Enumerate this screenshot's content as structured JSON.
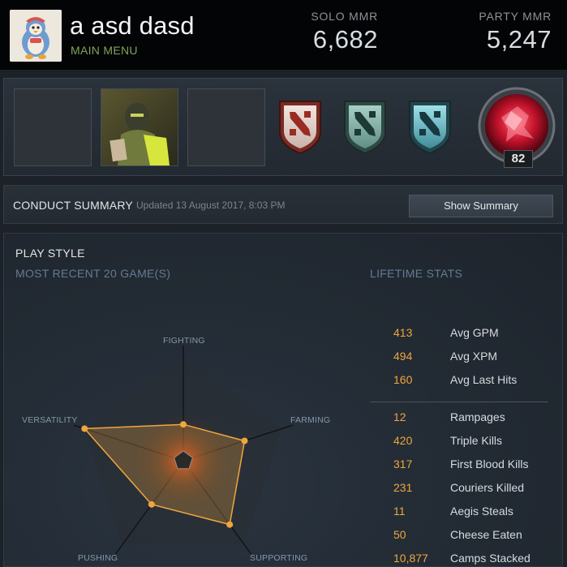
{
  "profile": {
    "player_name": "a asd dasd",
    "main_menu_label": "MAIN MENU",
    "avatar_icon": "penguin-avatar",
    "solo_mmr_label": "SOLO MMR",
    "solo_mmr_value": "6,682",
    "party_mmr_label": "PARTY MMR",
    "party_mmr_value": "5,247"
  },
  "showcase": {
    "hero_slots": [
      "empty-slot",
      "hero-portrait",
      "empty-slot"
    ],
    "badges": [
      "dota-badge-red",
      "dota-badge-teal",
      "dota-badge-cyan"
    ],
    "level_medal_icon": "level-medal",
    "level": "82"
  },
  "conduct": {
    "title": "CONDUCT SUMMARY",
    "updated": "Updated 13 August 2017, 8:03 PM",
    "button_label": "Show Summary"
  },
  "play_style": {
    "title": "PLAY STYLE",
    "recent_label": "MOST RECENT 20 GAME(S)",
    "lifetime_label": "LIFETIME STATS",
    "axes": [
      "FIGHTING",
      "FARMING",
      "SUPPORTING",
      "PUSHING",
      "VERSATILITY"
    ],
    "scores": {
      "FIGHTING": 0.35,
      "FARMING": 0.62,
      "SUPPORTING": 0.76,
      "PUSHING": 0.52,
      "VERSATILITY": 1.0
    }
  },
  "lifetime_stats": {
    "group1": [
      {
        "value": "413",
        "label": "Avg GPM"
      },
      {
        "value": "494",
        "label": "Avg XPM"
      },
      {
        "value": "160",
        "label": "Avg Last Hits"
      }
    ],
    "group2": [
      {
        "value": "12",
        "label": "Rampages"
      },
      {
        "value": "420",
        "label": "Triple Kills"
      },
      {
        "value": "317",
        "label": "First Blood Kills"
      },
      {
        "value": "231",
        "label": "Couriers Killed"
      },
      {
        "value": "11",
        "label": "Aegis Steals"
      },
      {
        "value": "50",
        "label": "Cheese Eaten"
      },
      {
        "value": "10,877",
        "label": "Camps Stacked"
      }
    ]
  },
  "colors": {
    "accent_orange": "#f0a63c",
    "menu_green": "#7fa55a",
    "section_blue": "#647b93"
  }
}
